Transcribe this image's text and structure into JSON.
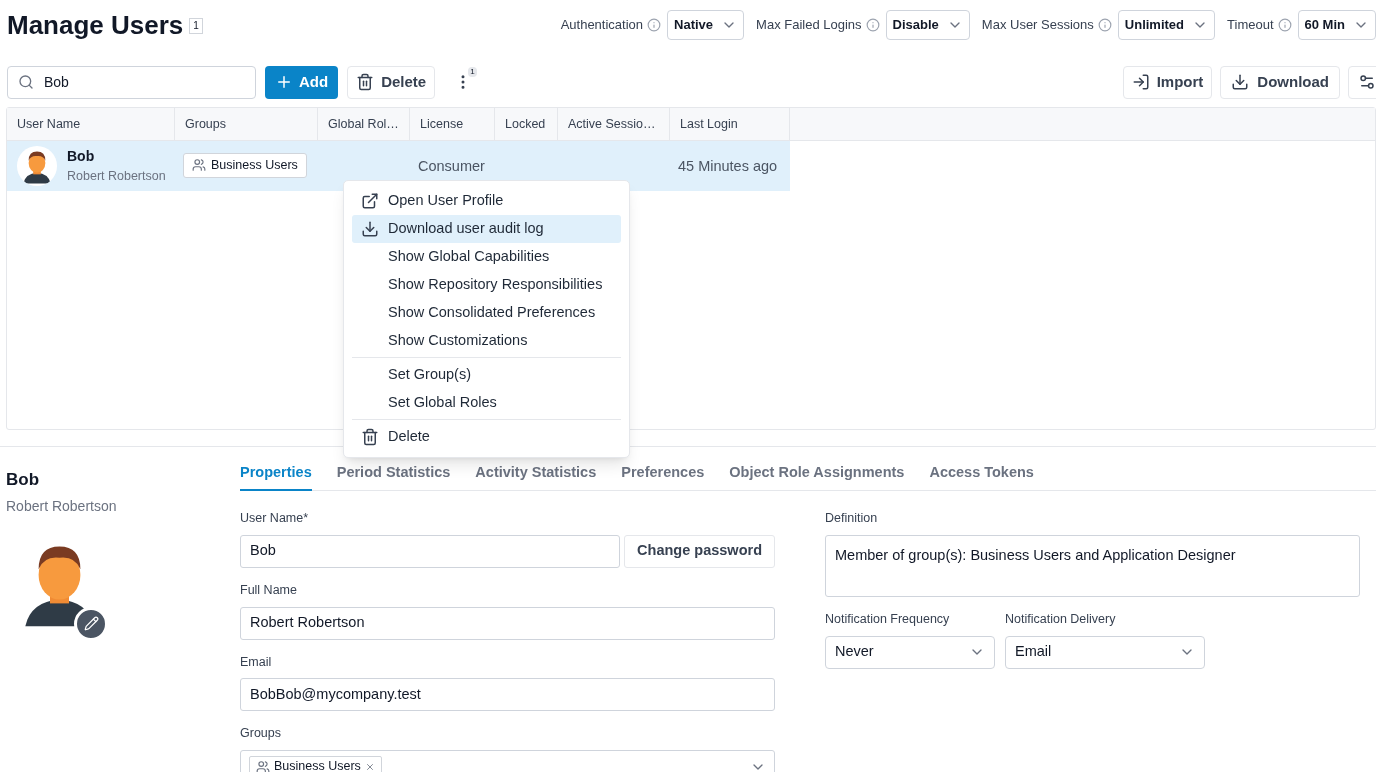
{
  "header": {
    "title": "Manage Users",
    "badge": "1",
    "settings": [
      {
        "label": "Authentication",
        "value": "Native"
      },
      {
        "label": "Max Failed Logins",
        "value": "Disable"
      },
      {
        "label": "Max User Sessions",
        "value": "Unlimited"
      },
      {
        "label": "Timeout",
        "value": "60 Min"
      }
    ]
  },
  "toolbar": {
    "search": {
      "value": "Bob"
    },
    "add": "Add",
    "delete": "Delete",
    "more_badge": "1",
    "import": "Import",
    "download": "Download"
  },
  "table": {
    "columns": [
      "User Name",
      "Groups",
      "Global Rol…",
      "License",
      "Locked",
      "Active Sessio…",
      "Last Login"
    ],
    "rows": [
      {
        "selected": true,
        "name": "Bob",
        "full_name": "Robert Robertson",
        "group": "Business Users",
        "global_roles": "",
        "license": "Consumer",
        "locked": "",
        "active_sessions": "",
        "last_login": "45 Minutes ago"
      }
    ]
  },
  "context_menu": {
    "groups": [
      [
        {
          "kind": "open",
          "label": "Open User Profile",
          "selected": false
        },
        {
          "kind": "download",
          "label": "Download user audit log",
          "selected": true
        },
        {
          "kind": "plain",
          "label": "Show Global Capabilities",
          "selected": false
        },
        {
          "kind": "plain",
          "label": "Show Repository Responsibilities",
          "selected": false
        },
        {
          "kind": "plain",
          "label": "Show Consolidated Preferences",
          "selected": false
        },
        {
          "kind": "plain",
          "label": "Show Customizations",
          "selected": false
        }
      ],
      [
        {
          "kind": "plain",
          "label": "Set Group(s)",
          "selected": false
        },
        {
          "kind": "plain",
          "label": "Set Global Roles",
          "selected": false
        }
      ],
      [
        {
          "kind": "delete",
          "label": "Delete",
          "selected": false
        }
      ]
    ]
  },
  "details": {
    "name": "Bob",
    "full_name": "Robert Robertson",
    "tabs": [
      {
        "label": "Properties",
        "selected": true
      },
      {
        "label": "Period Statistics",
        "selected": false
      },
      {
        "label": "Activity Statistics",
        "selected": false
      },
      {
        "label": "Preferences",
        "selected": false
      },
      {
        "label": "Object Role Assignments",
        "selected": false
      },
      {
        "label": "Access Tokens",
        "selected": false
      }
    ],
    "user_name": {
      "label": "User Name*",
      "value": "Bob"
    },
    "change_password": "Change password",
    "full_name_field": {
      "label": "Full Name",
      "value": "Robert Robertson"
    },
    "email": {
      "label": "Email",
      "value": "BobBob@mycompany.test"
    },
    "groups": {
      "label": "Groups",
      "chips": [
        "Business Users"
      ]
    },
    "definition": {
      "label": "Definition",
      "value": "Member of group(s): Business Users and Application Designer"
    },
    "notification_frequency": {
      "label": "Notification Frequency",
      "value": "Never"
    },
    "notification_delivery": {
      "label": "Notification Delivery",
      "value": "Email"
    }
  }
}
